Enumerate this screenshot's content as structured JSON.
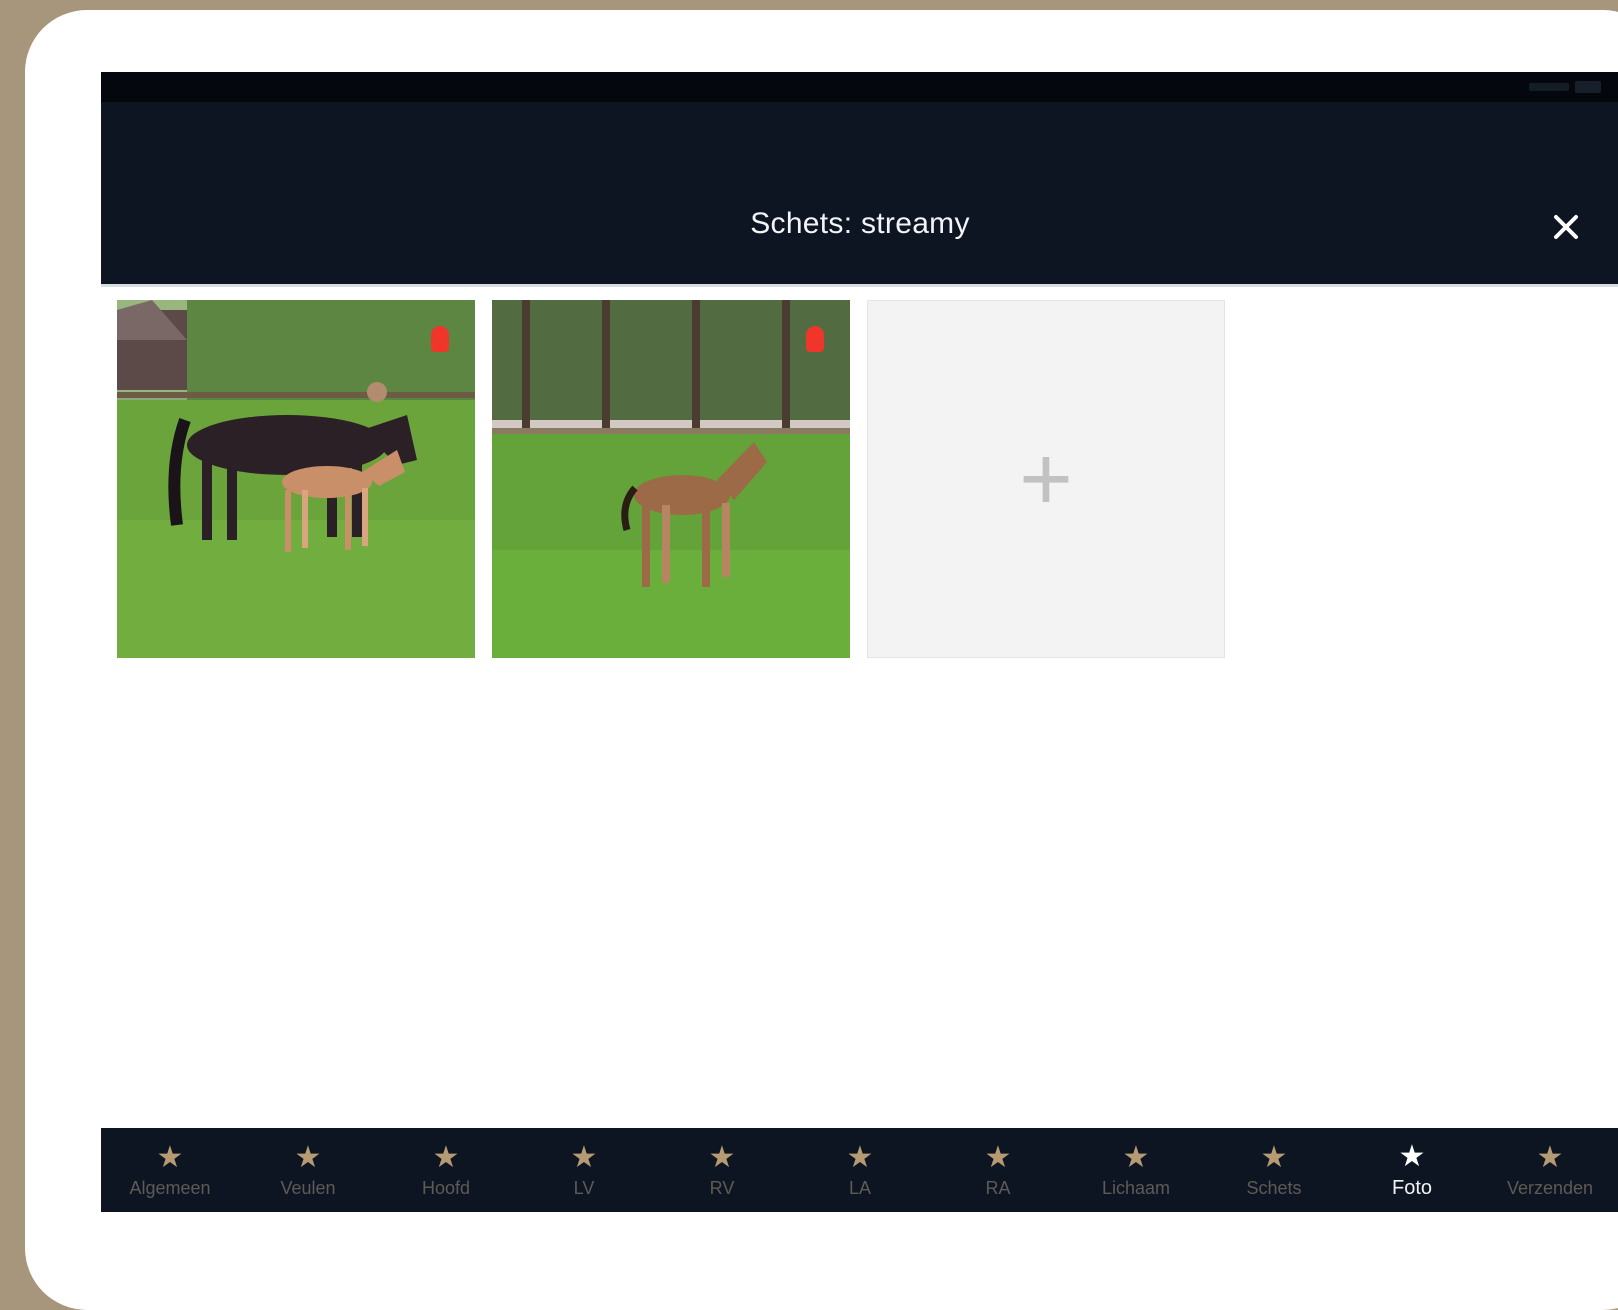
{
  "colors": {
    "frame": "#a8967c",
    "header_bg": "#0d1523",
    "nav_star": "#b59a74",
    "nav_star_active": "#ffffff",
    "delete_marker": "#f0362a",
    "add_tile_bg": "#f3f3f3"
  },
  "header": {
    "title": "Schets: streamy",
    "close_icon": "close-icon"
  },
  "gallery": {
    "photos": [
      {
        "subject": "mare-with-foal",
        "has_delete_marker": true
      },
      {
        "subject": "foal-in-meadow",
        "has_delete_marker": true
      }
    ],
    "add_icon": "plus-icon",
    "add_glyph": "+"
  },
  "bottom_nav": {
    "active_index": 9,
    "star_glyph": "★",
    "items": [
      {
        "label": "Algemeen"
      },
      {
        "label": "Veulen"
      },
      {
        "label": "Hoofd"
      },
      {
        "label": "LV"
      },
      {
        "label": "RV"
      },
      {
        "label": "LA"
      },
      {
        "label": "RA"
      },
      {
        "label": "Lichaam"
      },
      {
        "label": "Schets"
      },
      {
        "label": "Foto"
      },
      {
        "label": "Verzenden"
      }
    ]
  }
}
